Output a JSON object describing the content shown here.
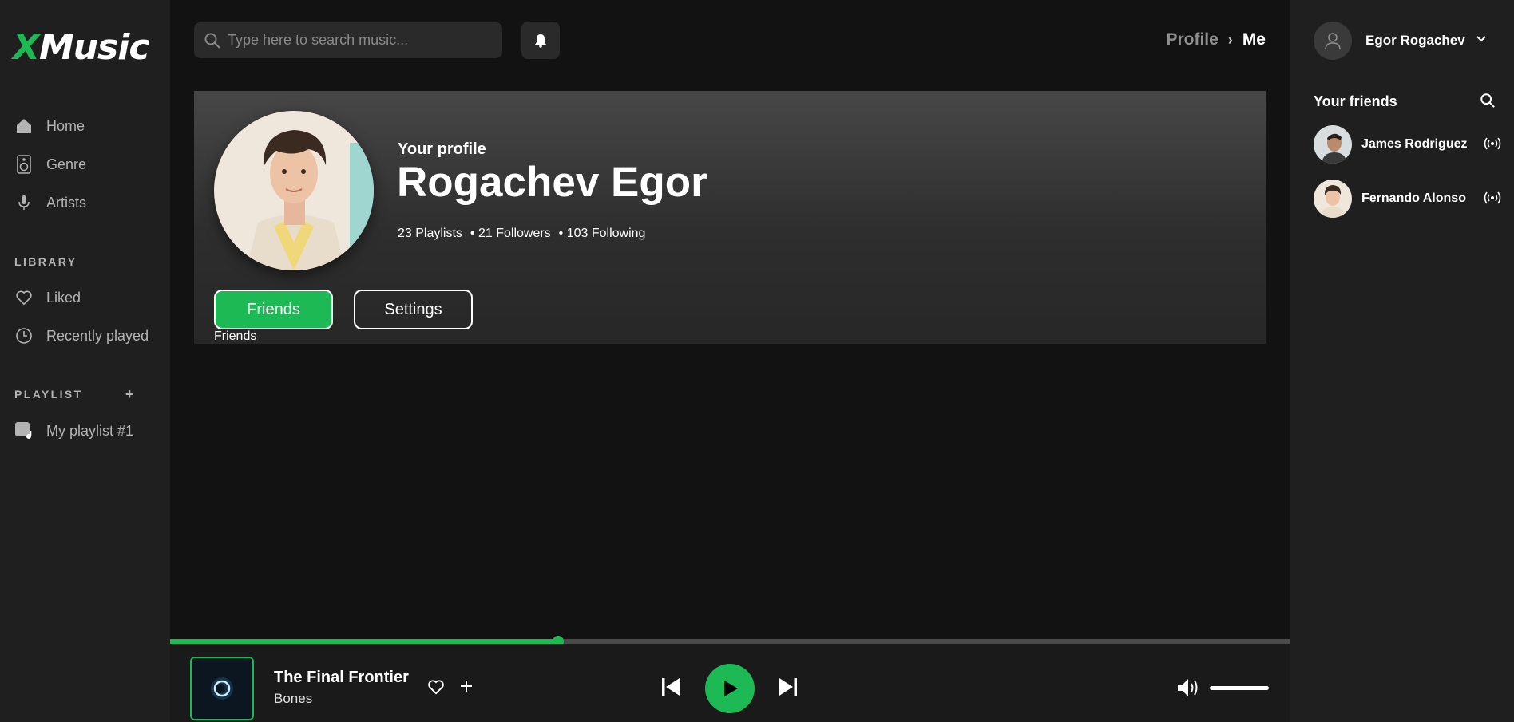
{
  "app": {
    "logo_x": "X",
    "logo_rest": "Music"
  },
  "sidebar": {
    "nav": [
      {
        "label": "Home",
        "icon": "home-icon"
      },
      {
        "label": "Genre",
        "icon": "speaker-icon"
      },
      {
        "label": "Artists",
        "icon": "microphone-icon"
      }
    ],
    "library_label": "LIBRARY",
    "library": [
      {
        "label": "Liked",
        "icon": "heart-icon"
      },
      {
        "label": "Recently played",
        "icon": "clock-icon"
      }
    ],
    "playlist_label": "PLAYLIST",
    "playlist_add": "+",
    "playlists": [
      {
        "label": "My playlist #1",
        "icon": "playlist-icon"
      }
    ]
  },
  "search": {
    "placeholder": "Type here to search music..."
  },
  "breadcrumb": {
    "parent": "Profile",
    "separator": "›",
    "current": "Me"
  },
  "profile": {
    "subtitle": "Your profile",
    "name": "Rogachev Egor",
    "stats": [
      "23 Playlists",
      "• 21 Followers",
      "• 103 Following"
    ],
    "friends_button": "Friends",
    "settings_button": "Settings",
    "active_tab_caption": "Friends"
  },
  "user": {
    "name": "Egor Rogachev"
  },
  "friends_panel": {
    "title": "Your friends",
    "friends": [
      {
        "name": "James Rodriguez"
      },
      {
        "name": "Fernando Alonso"
      }
    ]
  },
  "player": {
    "title": "The Final Frontier",
    "artist": "Bones",
    "progress": 0.347,
    "volume": 1.0
  },
  "colors": {
    "accent": "#1db954",
    "background": "#121212",
    "panel": "#1f1f1f"
  }
}
